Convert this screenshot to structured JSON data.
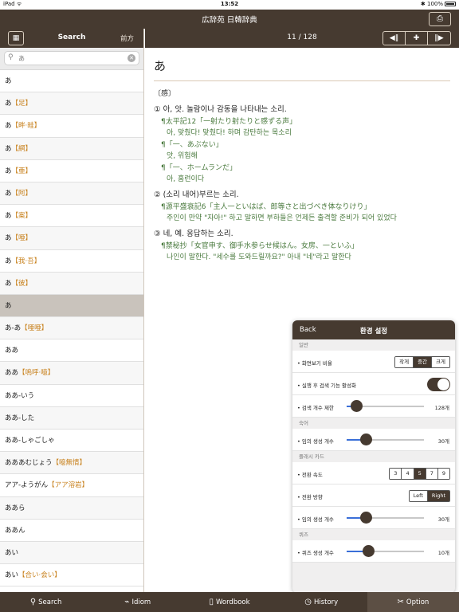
{
  "status": {
    "device": "iPad",
    "time": "13:52",
    "battery": "100%"
  },
  "app_title": "広辞苑 日韓辞典",
  "sidebar": {
    "tab_label": "Search",
    "prefix_label": "前方",
    "search_value": "あ",
    "items": [
      {
        "kana": "あ",
        "kanji": ""
      },
      {
        "kana": "あ",
        "kanji": "【足】"
      },
      {
        "kana": "あ",
        "kanji": "【畔·畦】"
      },
      {
        "kana": "あ",
        "kanji": "【網】"
      },
      {
        "kana": "あ",
        "kanji": "【亜】"
      },
      {
        "kana": "あ",
        "kanji": "【阿】"
      },
      {
        "kana": "あ",
        "kanji": "【案】"
      },
      {
        "kana": "あ",
        "kanji": "【唖】"
      },
      {
        "kana": "あ",
        "kanji": "【我·吾】"
      },
      {
        "kana": "あ",
        "kanji": "【彼】"
      },
      {
        "kana": "あ",
        "kanji": ""
      },
      {
        "kana": "あ-あ",
        "kanji": "【唖唖】"
      },
      {
        "kana": "ああ",
        "kanji": ""
      },
      {
        "kana": "ああ",
        "kanji": "【嗚呼·噫】"
      },
      {
        "kana": "ああ-いう",
        "kanji": ""
      },
      {
        "kana": "ああ-した",
        "kanji": ""
      },
      {
        "kana": "ああ-しゃごしゃ",
        "kanji": ""
      },
      {
        "kana": "あああむじょう",
        "kanji": "【噫無情】"
      },
      {
        "kana": "アア-ようがん",
        "kanji": "【アア溶岩】"
      },
      {
        "kana": "ああら",
        "kanji": ""
      },
      {
        "kana": "ああん",
        "kanji": ""
      },
      {
        "kana": "あい",
        "kanji": ""
      },
      {
        "kana": "あい",
        "kanji": "【合い·会い】"
      }
    ]
  },
  "main": {
    "counter": "11 / 128",
    "headword": "あ",
    "pos": "〔感〕",
    "senses": [
      {
        "num": "①",
        "text": "아, 앗. 놀람이나 감동을 나타내는 소리.",
        "quotes": [
          {
            "q": "¶太平記12「一射たり射たりと感ずる声」",
            "t": "아, 맞췄다! 맞췄다! 하며 감탄하는 목소리"
          },
          {
            "q": "¶「一、あぶない」",
            "t": "앗, 위험해"
          },
          {
            "q": "¶「一、ホームランだ」",
            "t": "아, 홈런이다"
          }
        ]
      },
      {
        "num": "②",
        "text": "(소리 내어)부르는 소리.",
        "quotes": [
          {
            "q": "¶源平盛衰記6「主人一といはば、郎等さと出づべき体なりけり」",
            "t": "주인이 만약 \"자아!\" 하고 말하면 부하들은 언제든 출격할 준비가 되어 있었다"
          }
        ]
      },
      {
        "num": "③",
        "text": "네, 예. 응답하는 소리.",
        "quotes": [
          {
            "q": "¶禁秘抄「女官申す、御手水参らせ候はん。女房、一といふ」",
            "t": "나인이 말한다. \"세수를 도와드릴까요?\" 아내 \"네\"라고 말한다"
          }
        ]
      }
    ]
  },
  "settings": {
    "back": "Back",
    "title": "환경 설정",
    "sections": {
      "general": "일반",
      "idiom": "숙어",
      "flashcard": "플래시 카드",
      "quiz": "퀴즈"
    },
    "rows": {
      "screen_ratio": {
        "label": "• 화면보기 비율",
        "options": [
          "작게",
          "중간",
          "크게"
        ],
        "selected": "중간"
      },
      "auto_search": {
        "label": "• 실행 후 검색 기능 활성화",
        "on": true
      },
      "search_limit": {
        "label": "• 검색 개수 제한",
        "value": "128개",
        "level": 0.12
      },
      "idiom_random": {
        "label": "• 임의 생성 개수",
        "value": "30개",
        "level": 0.25
      },
      "speed": {
        "label": "• 전환 속도",
        "options": [
          "3",
          "4",
          "5",
          "7",
          "9"
        ],
        "selected": "5"
      },
      "direction": {
        "label": "• 전환 방향",
        "options": [
          "Left",
          "Right"
        ],
        "selected": "Right"
      },
      "card_random": {
        "label": "• 임의 생성 개수",
        "value": "30개",
        "level": 0.25
      },
      "quiz_count": {
        "label": "• 퀴즈 생성 개수",
        "value": "10개",
        "level": 0.28
      }
    }
  },
  "tabs": [
    {
      "label": "Search",
      "icon": "magnifier-icon"
    },
    {
      "label": "Idiom",
      "icon": "idiom-icon"
    },
    {
      "label": "Wordbook",
      "icon": "book-icon"
    },
    {
      "label": "History",
      "icon": "clock-icon"
    },
    {
      "label": "Option",
      "icon": "tools-icon"
    }
  ],
  "active_tab": "Option"
}
